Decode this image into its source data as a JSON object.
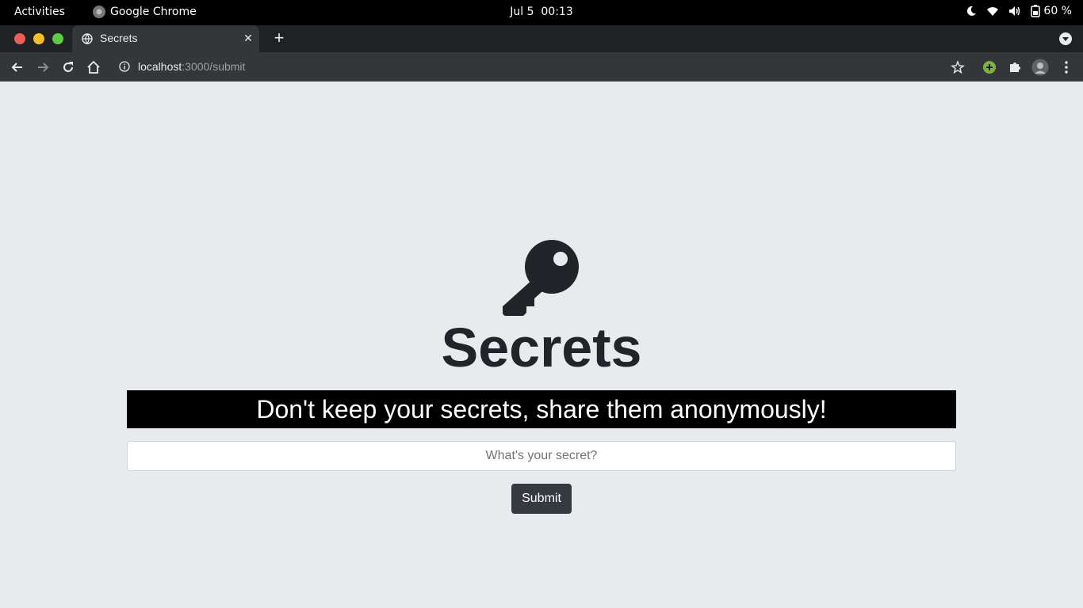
{
  "system_bar": {
    "activities_label": "Activities",
    "app_name": "Google Chrome",
    "date": "Jul 5",
    "time": "00:13",
    "battery": "60 %",
    "icons": [
      "night-light-icon",
      "wifi-icon",
      "volume-icon",
      "battery-icon"
    ]
  },
  "browser": {
    "tab_title": "Secrets",
    "url_host": "localhost",
    "url_path": ":3000/submit"
  },
  "page": {
    "icon": "key-icon",
    "title": "Secrets",
    "tagline": "Don't keep your secrets, share them anonymously!",
    "secret_input": {
      "placeholder": "What's your secret?",
      "value": ""
    },
    "submit_label": "Submit"
  },
  "colors": {
    "page_background": "#e8ebee",
    "text_dark": "#212529",
    "banner_background": "#000000",
    "button_background": "#343a40"
  }
}
